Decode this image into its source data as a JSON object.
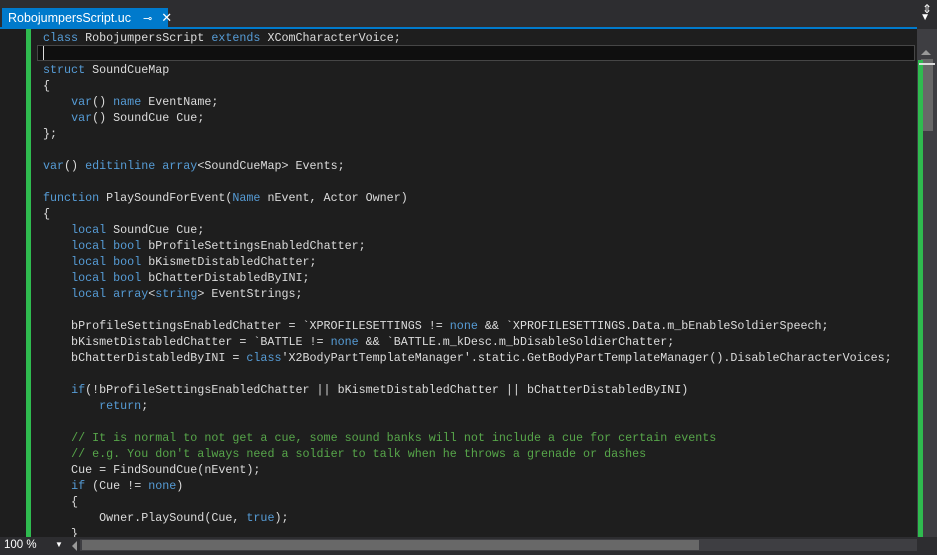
{
  "tab": {
    "title": "RobojumpersScript.uc",
    "pin_icon": "pin-icon",
    "close_icon": "close-icon"
  },
  "status": {
    "zoom": "100 %"
  },
  "code": [
    [
      [
        "k",
        "class"
      ],
      [
        "t",
        " RobojumpersScript "
      ],
      [
        "k",
        "extends"
      ],
      [
        "t",
        " XComCharacterVoice;"
      ]
    ],
    [],
    [
      [
        "k",
        "struct"
      ],
      [
        "t",
        " SoundCueMap"
      ]
    ],
    [
      [
        "t",
        "{"
      ]
    ],
    [
      [
        "t",
        "    "
      ],
      [
        "k",
        "var"
      ],
      [
        "t",
        "() "
      ],
      [
        "k",
        "name"
      ],
      [
        "t",
        " EventName;"
      ]
    ],
    [
      [
        "t",
        "    "
      ],
      [
        "k",
        "var"
      ],
      [
        "t",
        "() SoundCue Cue;"
      ]
    ],
    [
      [
        "t",
        "};"
      ]
    ],
    [],
    [
      [
        "k",
        "var"
      ],
      [
        "t",
        "() "
      ],
      [
        "k",
        "editinline"
      ],
      [
        "t",
        " "
      ],
      [
        "k",
        "array"
      ],
      [
        "t",
        "<SoundCueMap> Events;"
      ]
    ],
    [],
    [
      [
        "k",
        "function"
      ],
      [
        "t",
        " PlaySoundForEvent("
      ],
      [
        "k",
        "Name"
      ],
      [
        "t",
        " nEvent, Actor Owner)"
      ]
    ],
    [
      [
        "t",
        "{"
      ]
    ],
    [
      [
        "t",
        "    "
      ],
      [
        "k",
        "local"
      ],
      [
        "t",
        " SoundCue Cue;"
      ]
    ],
    [
      [
        "t",
        "    "
      ],
      [
        "k",
        "local"
      ],
      [
        "t",
        " "
      ],
      [
        "k",
        "bool"
      ],
      [
        "t",
        " bProfileSettingsEnabledChatter;"
      ]
    ],
    [
      [
        "t",
        "    "
      ],
      [
        "k",
        "local"
      ],
      [
        "t",
        " "
      ],
      [
        "k",
        "bool"
      ],
      [
        "t",
        " bKismetDistabledChatter;"
      ]
    ],
    [
      [
        "t",
        "    "
      ],
      [
        "k",
        "local"
      ],
      [
        "t",
        " "
      ],
      [
        "k",
        "bool"
      ],
      [
        "t",
        " bChatterDistabledByINI;"
      ]
    ],
    [
      [
        "t",
        "    "
      ],
      [
        "k",
        "local"
      ],
      [
        "t",
        " "
      ],
      [
        "k",
        "array"
      ],
      [
        "t",
        "<"
      ],
      [
        "k",
        "string"
      ],
      [
        "t",
        "> EventStrings;"
      ]
    ],
    [],
    [
      [
        "t",
        "    bProfileSettingsEnabledChatter = `XPROFILESETTINGS != "
      ],
      [
        "k",
        "none"
      ],
      [
        "t",
        " && `XPROFILESETTINGS.Data.m_bEnableSoldierSpeech;"
      ]
    ],
    [
      [
        "t",
        "    bKismetDistabledChatter = `BATTLE != "
      ],
      [
        "k",
        "none"
      ],
      [
        "t",
        " && `BATTLE.m_kDesc.m_bDisableSoldierChatter;"
      ]
    ],
    [
      [
        "t",
        "    bChatterDistabledByINI = "
      ],
      [
        "k",
        "class"
      ],
      [
        "t",
        "'X2BodyPartTemplateManager'.static.GetBodyPartTemplateManager().DisableCharacterVoices;"
      ]
    ],
    [],
    [
      [
        "t",
        "    "
      ],
      [
        "k",
        "if"
      ],
      [
        "t",
        "(!bProfileSettingsEnabledChatter || bKismetDistabledChatter || bChatterDistabledByINI)"
      ]
    ],
    [
      [
        "t",
        "        "
      ],
      [
        "k",
        "return"
      ],
      [
        "t",
        ";"
      ]
    ],
    [],
    [
      [
        "t",
        "    "
      ],
      [
        "c",
        "// It is normal to not get a cue, some sound banks will not include a cue for certain events"
      ]
    ],
    [
      [
        "t",
        "    "
      ],
      [
        "c",
        "// e.g. You don't always need a soldier to talk when he throws a grenade or dashes"
      ]
    ],
    [
      [
        "t",
        "    Cue = FindSoundCue(nEvent);"
      ]
    ],
    [
      [
        "t",
        "    "
      ],
      [
        "k",
        "if"
      ],
      [
        "t",
        " (Cue != "
      ],
      [
        "k",
        "none"
      ],
      [
        "t",
        ")"
      ]
    ],
    [
      [
        "t",
        "    {"
      ]
    ],
    [
      [
        "t",
        "        Owner.PlaySound(Cue, "
      ],
      [
        "k",
        "true"
      ],
      [
        "t",
        ");"
      ]
    ],
    [
      [
        "t",
        "    }"
      ]
    ]
  ]
}
